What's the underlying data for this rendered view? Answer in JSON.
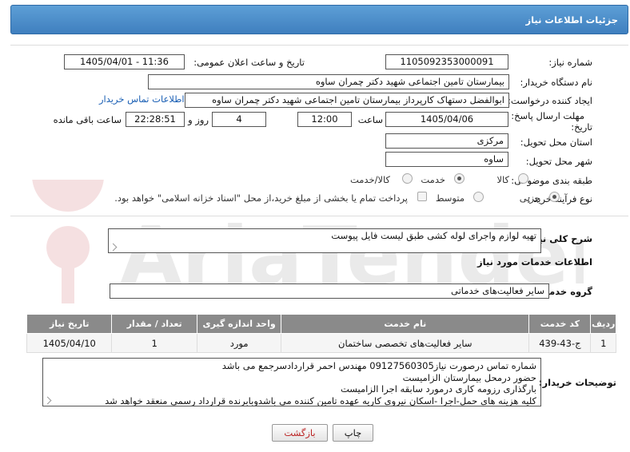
{
  "header": {
    "title": "جزئیات اطلاعات نیاز"
  },
  "form": {
    "need_number_label": "شماره نیاز:",
    "need_number": "1105092353000091",
    "announce_label": "تاریخ و ساعت اعلان عمومی:",
    "announce_value": "1405/04/01 - 11:36",
    "buyer_label": "نام دستگاه خریدار:",
    "buyer_value": "بیمارستان تامین اجتماعی شهید دکتر چمران ساوه",
    "creator_label": "ایجاد کننده درخواست:",
    "creator_value": "ابوالفضل  دستهاک  کارپرداز بیمارستان تامین اجتماعی شهید دکتر چمران ساوه",
    "contact_link": "اطلاعات تماس خریدار",
    "deadline_label_1": "مهلت ارسال پاسخ: تا",
    "deadline_label_2": "تاریخ:",
    "deadline_date": "1405/04/06",
    "time_label": "ساعت",
    "deadline_time": "12:00",
    "days_value": "4",
    "days_label": "روز و",
    "remaining_time": "22:28:51",
    "remaining_label": "ساعت باقی مانده",
    "province_label": "استان محل تحویل:",
    "province_value": "مرکزی",
    "city_label": "شهر محل تحویل:",
    "city_value": "ساوه",
    "category_label": "طبقه بندی موضوعی:",
    "category_options": [
      "کالا",
      "خدمت",
      "کالا/خدمت"
    ],
    "category_selected": "خدمت",
    "process_label": "نوع فرآیند خرید :",
    "process_options": [
      "جزیی",
      "متوسط"
    ],
    "process_selected": "جزیی",
    "payment_note": "پرداخت تمام یا بخشی از مبلغ خرید،از محل \"اسناد خزانه اسلامی\" خواهد بود."
  },
  "summary": {
    "label": "شرح کلی نیاز:",
    "value": "تهیه لوازم واجرای لوله کشی طبق لیست فایل پیوست"
  },
  "services": {
    "section_title": "اطلاعات خدمات مورد نیاز",
    "group_label": "گروه خدمت:",
    "group_value": "سایر فعالیت‌های خدماتی",
    "columns": [
      "ردیف",
      "کد خدمت",
      "نام خدمت",
      "واحد اندازه گیری",
      "تعداد / مقدار",
      "تاریخ نیاز"
    ],
    "rows": [
      [
        "1",
        "ج-43-439",
        "سایر فعالیت‌های تخصصی ساختمان",
        "مورد",
        "1",
        "1405/04/10"
      ]
    ]
  },
  "buyer_notes": {
    "label": "توضیحات خریدار:",
    "lines": [
      "شماره تماس درصورت نیاز09127560305 مهندس احمر قراردادسرجمع می باشد",
      "حضور درمحل بیمارستان الزامیست",
      "بارگذاری رزومه کاری درمورد سابقه اجرا الزامیست",
      "کلیه هزینه های حمل-اجرا -اسکان نیروی کاریه عهده تامین کننده می باشدوبابرنده قرارداد رسمی منعقد خواهد شد"
    ]
  },
  "buttons": {
    "print": "چاپ",
    "back": "بازگشت"
  },
  "watermark": {
    "text": "AriaTender.neT"
  },
  "colors": {
    "header": "#4a8cc9",
    "link": "#1a5fb4",
    "table_header": "#8a8a8a",
    "back_text": "#b22222"
  }
}
